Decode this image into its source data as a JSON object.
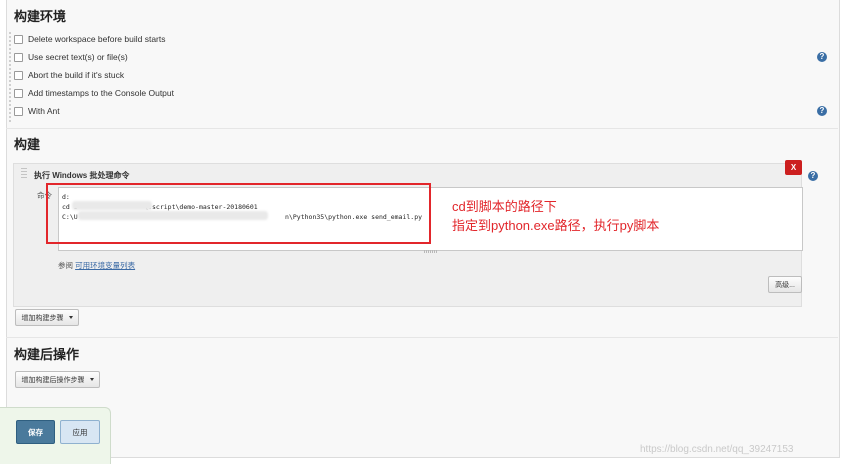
{
  "env_section": {
    "title": "构建环境",
    "options": [
      {
        "label": "Delete workspace before build starts",
        "checked": false,
        "help": false
      },
      {
        "label": "Use secret text(s) or file(s)",
        "checked": false,
        "help": true
      },
      {
        "label": "Abort the build if it's stuck",
        "checked": false,
        "help": false
      },
      {
        "label": "Add timestamps to the Console Output",
        "checked": false,
        "help": false
      },
      {
        "label": "With Ant",
        "checked": false,
        "help": true
      }
    ]
  },
  "build_section": {
    "title": "构建",
    "step": {
      "title": "执行 Windows 批处理命令",
      "close_label": "X",
      "command_label": "命令",
      "command_lines": [
        "d:",
        "cd I                 \\.script\\demo-master-20180601",
        "C:\\U                                                     n\\Python35\\python.exe send_email.py"
      ],
      "ref_prefix": "参阅",
      "ref_link": "可用环境变量列表",
      "advanced_label": "高级..."
    },
    "add_step_label": "增加构建步骤"
  },
  "post_section": {
    "title": "构建后操作",
    "add_post_label": "增加构建后操作步骤"
  },
  "annotation": {
    "line1": "cd到脚本的路径下",
    "line2": "指定到python.exe路径，执行py脚本",
    "color": "#e2262b"
  },
  "footer": {
    "save_label": "保存",
    "apply_label": "应用"
  },
  "help_glyph": "?",
  "watermark": "https://blog.csdn.net/qq_39247153"
}
